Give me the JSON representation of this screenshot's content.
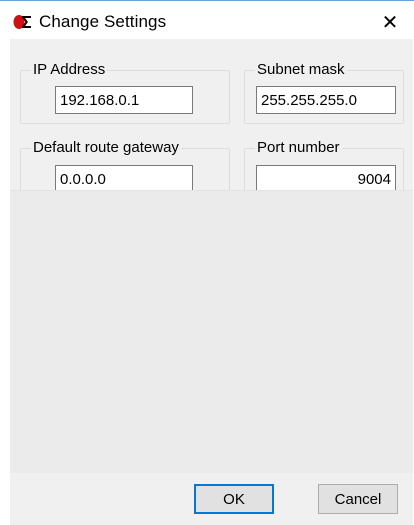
{
  "window": {
    "title": "Change Settings",
    "close_glyph": "✕",
    "accent": "#0078d7"
  },
  "icons": {
    "app": "app-logo-icon",
    "close": "close-icon"
  },
  "groups": {
    "ip": {
      "label": "IP Address",
      "value": "192.168.0.1"
    },
    "subnet": {
      "label": "Subnet mask",
      "value": "255.255.255.0"
    },
    "gateway": {
      "label": "Default route gateway",
      "value": "0.0.0.0"
    },
    "port": {
      "label": "Port number",
      "value": "9004"
    }
  },
  "buttons": {
    "ok": "OK",
    "cancel": "Cancel"
  }
}
